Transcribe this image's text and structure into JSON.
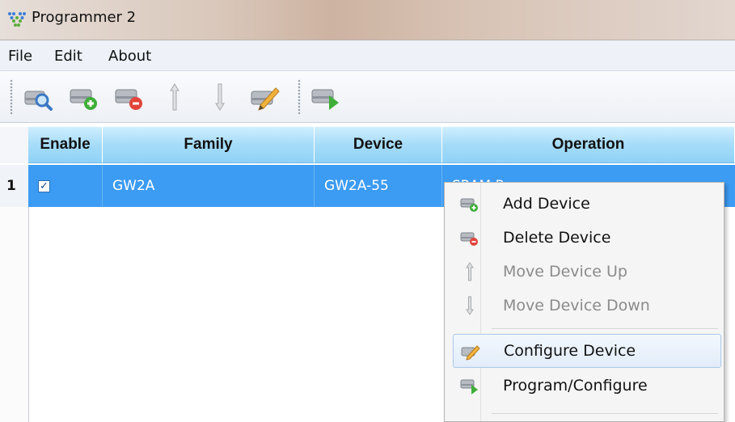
{
  "window": {
    "title": "Programmer 2"
  },
  "menu": [
    "File",
    "Edit",
    "About"
  ],
  "toolbar": {
    "buttons": [
      "scan-device-icon",
      "add-device-icon",
      "delete-device-icon",
      "move-up-icon",
      "move-down-icon",
      "configure-device-icon",
      "program-icon"
    ]
  },
  "table": {
    "columns": [
      "Enable",
      "Family",
      "Device",
      "Operation"
    ],
    "rows": [
      {
        "index": "1",
        "enabled": true,
        "family": "GW2A",
        "device": "GW2A-55",
        "operation": "SRAM Program"
      }
    ]
  },
  "context_menu": {
    "items": [
      {
        "label": "Add Device",
        "icon": "add-device-icon",
        "enabled": true
      },
      {
        "label": "Delete Device",
        "icon": "delete-device-icon",
        "enabled": true
      },
      {
        "label": "Move Device Up",
        "icon": "move-up-icon",
        "enabled": false
      },
      {
        "label": "Move Device Down",
        "icon": "move-down-icon",
        "enabled": false
      },
      {
        "label": "Configure Device",
        "icon": "configure-device-icon",
        "enabled": true,
        "highlighted": true
      },
      {
        "label": "Program/Configure",
        "icon": "program-icon",
        "enabled": true
      }
    ]
  },
  "colors": {
    "selected_row": "#3c9bf2",
    "header_gradient_top": "#cfeeff",
    "header_gradient_bottom": "#8fd2f6",
    "menu_highlight_border": "#aac8ea"
  }
}
